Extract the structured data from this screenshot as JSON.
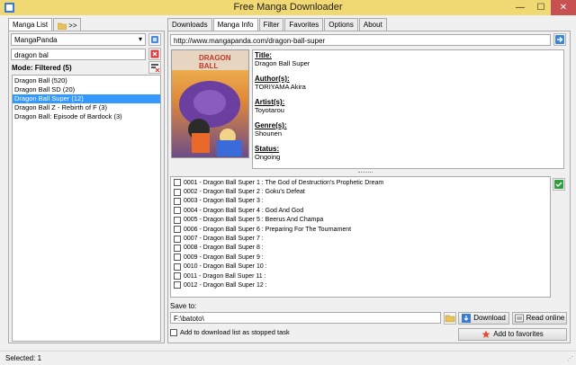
{
  "window": {
    "title": "Free Manga Downloader",
    "minimize_glyph": "—",
    "maximize_glyph": "☐",
    "close_glyph": "✕"
  },
  "left_tabs": [
    "Manga List",
    ">>"
  ],
  "source_select": {
    "value": "MangaPanda"
  },
  "search": {
    "value": "dragon bal"
  },
  "mode_label": "Mode: Filtered (5)",
  "manga_list": [
    {
      "label": "Dragon Ball (520)",
      "selected": false
    },
    {
      "label": "Dragon Ball SD (20)",
      "selected": false
    },
    {
      "label": "Dragon Ball Super (12)",
      "selected": true
    },
    {
      "label": "Dragon Ball Z - Rebirth of F (3)",
      "selected": false
    },
    {
      "label": "Dragon Ball: Episode of Bardock (3)",
      "selected": false
    }
  ],
  "right_tabs": [
    "Downloads",
    "Manga Info",
    "Filter",
    "Favorites",
    "Options",
    "About"
  ],
  "active_right_tab": "Manga Info",
  "url": {
    "value": "http://www.mangapanda.com/dragon-ball-super"
  },
  "info": {
    "title_label": "Title:",
    "title_value": "Dragon Ball Super",
    "authors_label": "Author(s):",
    "authors_value": "TORIYAMA Akira",
    "artists_label": "Artist(s):",
    "artists_value": "Toyotarou",
    "genres_label": "Genre(s):",
    "genres_value": "Shounen",
    "status_label": "Status:",
    "status_value": "Ongoing"
  },
  "cover": {
    "logo_text": "DRAGON BALL"
  },
  "chapters": [
    "0001 - Dragon Ball Super 1 : The God of Destruction's Prophetic Dream",
    "0002 - Dragon Ball Super 2 : Goku's Defeat",
    "0003 - Dragon Ball Super 3 :",
    "0004 - Dragon Ball Super 4 : God And God",
    "0005 - Dragon Ball Super 5 : Beerus And Champa",
    "0006 - Dragon Ball Super 6 : Preparing For The Tournament",
    "0007 - Dragon Ball Super 7 :",
    "0008 - Dragon Ball Super 8 :",
    "0009 - Dragon Ball Super 9 :",
    "0010 - Dragon Ball Super 10 :",
    "0011 - Dragon Ball Super 11 :",
    "0012 - Dragon Ball Super 12 :"
  ],
  "save_to": {
    "label": "Save to:",
    "value": "F:\\batoto\\"
  },
  "stopped_task_label": "Add to download list as stopped task",
  "buttons": {
    "download": "Download",
    "read_online": "Read online",
    "add_favorites": "Add to favorites"
  },
  "status": {
    "selected": "Selected: 1"
  },
  "colors": {
    "titlebar": "#f0d872",
    "selection": "#3399ff",
    "close": "#c75050"
  },
  "icons": [
    "app-icon",
    "folder-icon",
    "refresh-icon",
    "clear-icon",
    "mode-filter-icon",
    "go-arrow-icon",
    "check-all-icon",
    "browse-folder-icon",
    "download-icon",
    "read-online-icon",
    "favorite-icon"
  ]
}
